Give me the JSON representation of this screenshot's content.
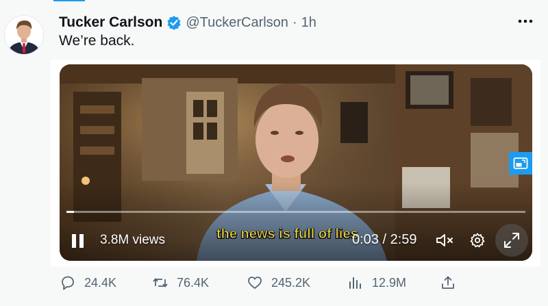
{
  "tweet": {
    "author_name": "Tucker Carlson",
    "handle": "@TuckerCarlson",
    "separator": "·",
    "time": "1h",
    "text": "We’re back."
  },
  "video": {
    "views": "3.8M views",
    "caption": "the news is full of lies",
    "timecode": "0:03 / 2:59",
    "progress": 0.017
  },
  "actions": {
    "replies": "24.4K",
    "retweets": "76.4K",
    "likes": "245.2K",
    "views": "12.9M"
  },
  "icons": {
    "verified": "verified-badge-icon",
    "more": "more-dots-icon",
    "pip": "picture-in-picture-icon",
    "pause": "pause-icon",
    "mute": "mute-icon",
    "settings": "gear-icon",
    "fullscreen": "fullscreen-icon",
    "reply": "reply-icon",
    "retweet": "retweet-icon",
    "like": "heart-icon",
    "analytics": "analytics-icon",
    "share": "share-icon"
  },
  "colors": {
    "accent": "#1d9bf0",
    "caption": "#e3cf43",
    "secondary_text": "#536471"
  }
}
